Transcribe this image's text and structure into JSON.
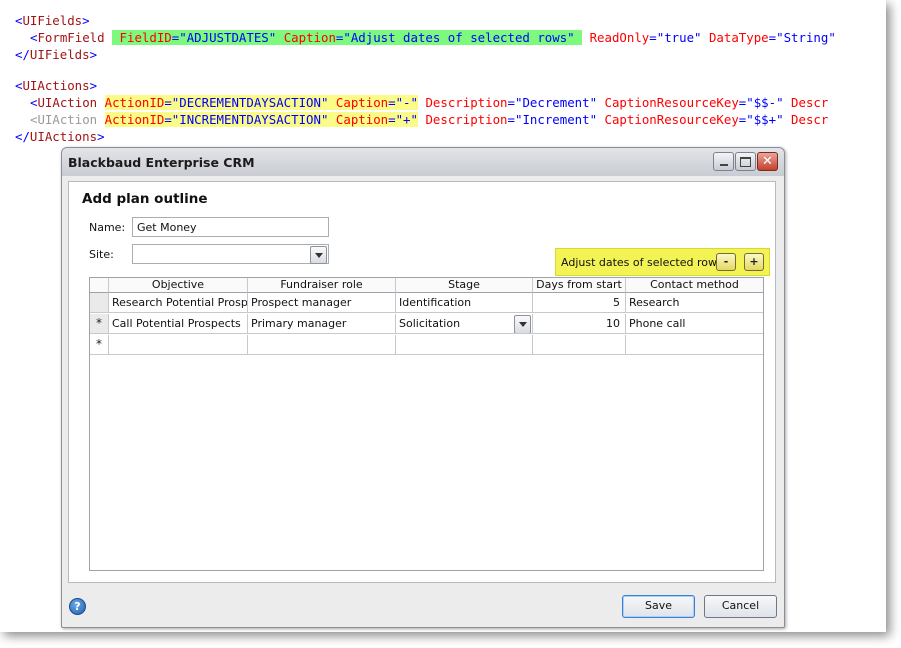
{
  "xml": {
    "l1": {
      "open": "<",
      "tag": "UIFields",
      "close": ">"
    },
    "l2": {
      "open": "<",
      "tag": "FormField",
      "hl_fieldid_attr": "FieldID",
      "hl_fieldid_val": "\"ADJUSTDATES\"",
      "hl_caption_attr": "Caption",
      "hl_caption_val": "\"Adjust dates of selected rows\"",
      "readonly_attr": "ReadOnly",
      "readonly_val": "\"true\"",
      "datatype_attr": "DataType",
      "datatype_val": "\"String\""
    },
    "l3": {
      "open": "</",
      "tag": "UIFields",
      "close": ">"
    },
    "l4": {
      "open": "<",
      "tag": "UIActions",
      "close": ">"
    },
    "l5": {
      "open": "<",
      "tag": "UIAction",
      "actionid_attr": "ActionID",
      "actionid_val": "\"DECREMENTDAYSACTION\"",
      "caption_attr": "Caption",
      "caption_val": "\"-\"",
      "desc_attr": "Description",
      "desc_val": "\"Decrement\"",
      "crk_attr": "CaptionResourceKey",
      "crk_val": "\"$$-\"",
      "tail": "Descr"
    },
    "l6": {
      "open": "<",
      "tag": "UIAction",
      "actionid_attr": "ActionID",
      "actionid_val": "\"INCREMENTDAYSACTION\"",
      "caption_attr": "Caption",
      "caption_val": "\"+\"",
      "desc_attr": "Description",
      "desc_val": "\"Increment\"",
      "crk_attr": "CaptionResourceKey",
      "crk_val": "\"$$+\"",
      "tail": "Descr"
    },
    "l7": {
      "open": "</",
      "tag": "UIActions",
      "close": ">"
    },
    "eq": "="
  },
  "window": {
    "title": "Blackbaud Enterprise CRM",
    "heading": "Add plan outline",
    "name_label": "Name:",
    "name_value": "Get Money",
    "site_label": "Site:",
    "site_value": "",
    "adjust_label": "Adjust dates of selected rows:",
    "minus_label": "-",
    "plus_label": "+",
    "save_label": "Save",
    "cancel_label": "Cancel"
  },
  "grid": {
    "columns": [
      "Objective",
      "Fundraiser role",
      "Stage",
      "Days from start",
      "Contact method"
    ],
    "rows": [
      {
        "objective": "Research Potential Prospects",
        "role": "Prospect manager",
        "stage": "Identification",
        "days": "5",
        "contact": "Research"
      },
      {
        "objective": "Call Potential Prospects",
        "role": "Primary manager",
        "stage": "Solicitation",
        "days": "10",
        "contact": "Phone call"
      }
    ],
    "new_row_marker": "*"
  },
  "colors": {
    "highlight_green": "#7dfa7d",
    "highlight_yellow": "#fbfb88",
    "adjust_panel": "#f3f355"
  }
}
